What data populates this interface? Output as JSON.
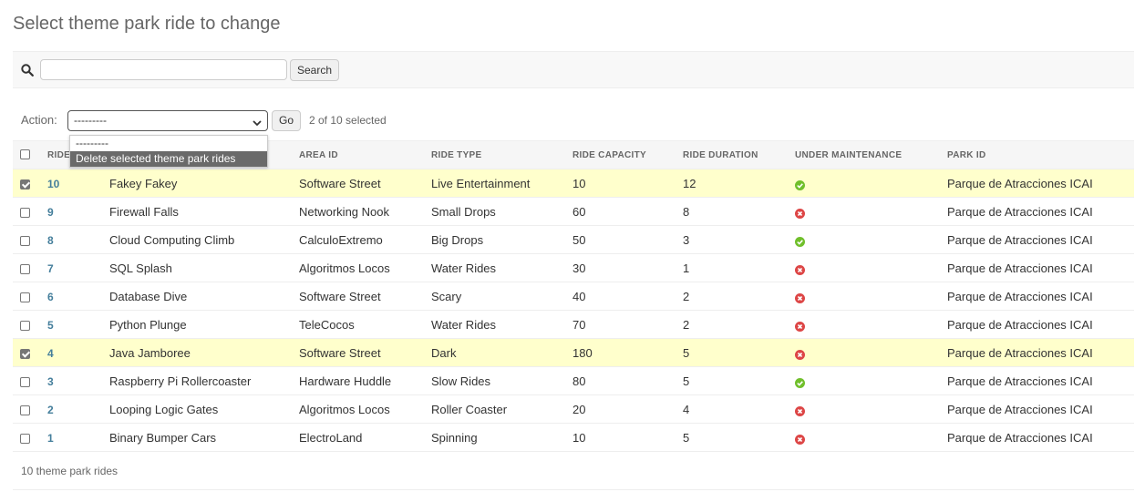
{
  "page": {
    "title": "Select theme park ride to change"
  },
  "search": {
    "value": "",
    "placeholder": "",
    "button_label": "Search"
  },
  "actions": {
    "label": "Action:",
    "selected_value": "---------",
    "options": [
      "---------",
      "Delete selected theme park rides"
    ],
    "go_label": "Go",
    "selection_text": "2 of 10 selected"
  },
  "table": {
    "headers": [
      "RIDE",
      "",
      "AREA ID",
      "RIDE TYPE",
      "RIDE CAPACITY",
      "RIDE DURATION",
      "UNDER MAINTENANCE",
      "PARK ID"
    ],
    "rows": [
      {
        "checked": true,
        "id": "10",
        "name": "Fakey Fakey",
        "area": "Software Street",
        "type": "Live Entertainment",
        "capacity": "10",
        "duration": "12",
        "maintenance": true,
        "park": "Parque de Atracciones ICAI"
      },
      {
        "checked": false,
        "id": "9",
        "name": "Firewall Falls",
        "area": "Networking Nook",
        "type": "Small Drops",
        "capacity": "60",
        "duration": "8",
        "maintenance": false,
        "park": "Parque de Atracciones ICAI"
      },
      {
        "checked": false,
        "id": "8",
        "name": "Cloud Computing Climb",
        "area": "CalculoExtremo",
        "type": "Big Drops",
        "capacity": "50",
        "duration": "3",
        "maintenance": true,
        "park": "Parque de Atracciones ICAI"
      },
      {
        "checked": false,
        "id": "7",
        "name": "SQL Splash",
        "area": "Algoritmos Locos",
        "type": "Water Rides",
        "capacity": "30",
        "duration": "1",
        "maintenance": false,
        "park": "Parque de Atracciones ICAI"
      },
      {
        "checked": false,
        "id": "6",
        "name": "Database Dive",
        "area": "Software Street",
        "type": "Scary",
        "capacity": "40",
        "duration": "2",
        "maintenance": false,
        "park": "Parque de Atracciones ICAI"
      },
      {
        "checked": false,
        "id": "5",
        "name": "Python Plunge",
        "area": "TeleCocos",
        "type": "Water Rides",
        "capacity": "70",
        "duration": "2",
        "maintenance": false,
        "park": "Parque de Atracciones ICAI"
      },
      {
        "checked": true,
        "id": "4",
        "name": "Java Jamboree",
        "area": "Software Street",
        "type": "Dark",
        "capacity": "180",
        "duration": "5",
        "maintenance": false,
        "park": "Parque de Atracciones ICAI"
      },
      {
        "checked": false,
        "id": "3",
        "name": "Raspberry Pi Rollercoaster",
        "area": "Hardware Huddle",
        "type": "Slow Rides",
        "capacity": "80",
        "duration": "5",
        "maintenance": true,
        "park": "Parque de Atracciones ICAI"
      },
      {
        "checked": false,
        "id": "2",
        "name": "Looping Logic Gates",
        "area": "Algoritmos Locos",
        "type": "Roller Coaster",
        "capacity": "20",
        "duration": "4",
        "maintenance": false,
        "park": "Parque de Atracciones ICAI"
      },
      {
        "checked": false,
        "id": "1",
        "name": "Binary Bumper Cars",
        "area": "ElectroLand",
        "type": "Spinning",
        "capacity": "10",
        "duration": "5",
        "maintenance": false,
        "park": "Parque de Atracciones ICAI"
      }
    ]
  },
  "footer": {
    "count_text": "10 theme park rides"
  },
  "colors": {
    "link": "#447e9b",
    "selected_row": "#ffffcc",
    "yes_icon": "#70bf2b",
    "no_icon": "#dd4646"
  }
}
